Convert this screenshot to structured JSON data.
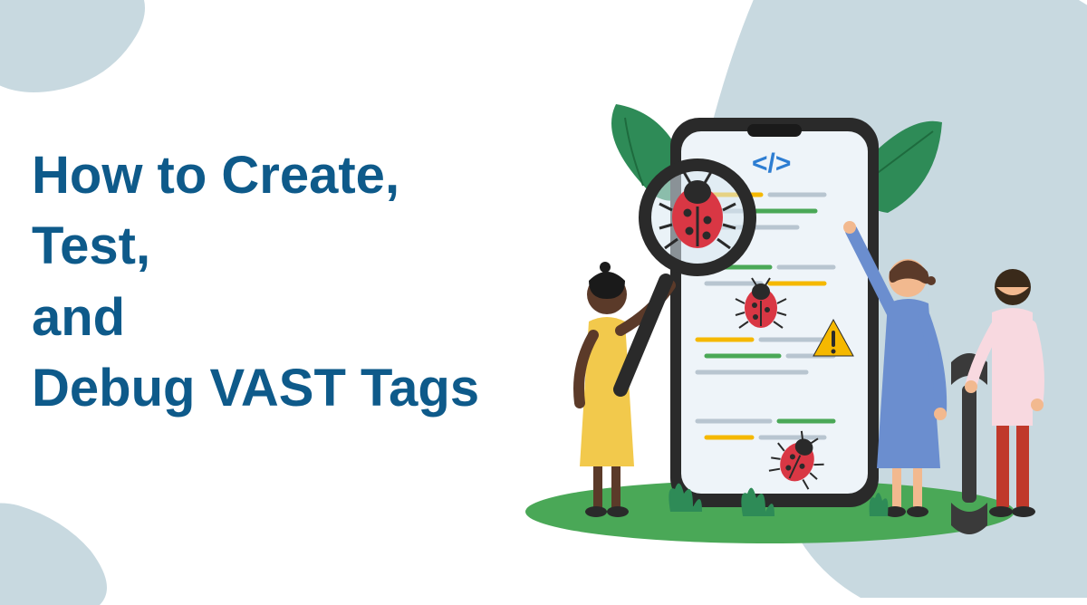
{
  "heading": {
    "line1": "How to Create,",
    "line2": "Test,",
    "line3": "and",
    "line4": "Debug VAST Tags"
  },
  "colors": {
    "title": "#0e5a8a",
    "blob": "#c8d9e0",
    "leaf": "#2e8b57",
    "bug_body": "#d93744",
    "phone_frame": "#2a2a2a",
    "phone_screen": "#eef4f9",
    "warning": "#f5b800",
    "grass": "#4aa857",
    "person1_dress": "#f2c94c",
    "person1_skin": "#5b3a29",
    "person2_dress": "#6b8ecf",
    "person2_skin": "#f2b98f",
    "person3_shirt": "#f8d9e0",
    "person3_pants": "#c0392b",
    "wrench": "#3a3a3a",
    "code_symbol": "#2d7dd2"
  },
  "icons": {
    "code": "</>",
    "bug": "bug-icon",
    "warning": "warning-icon",
    "magnifier": "magnifier-icon",
    "wrench": "wrench-icon"
  }
}
